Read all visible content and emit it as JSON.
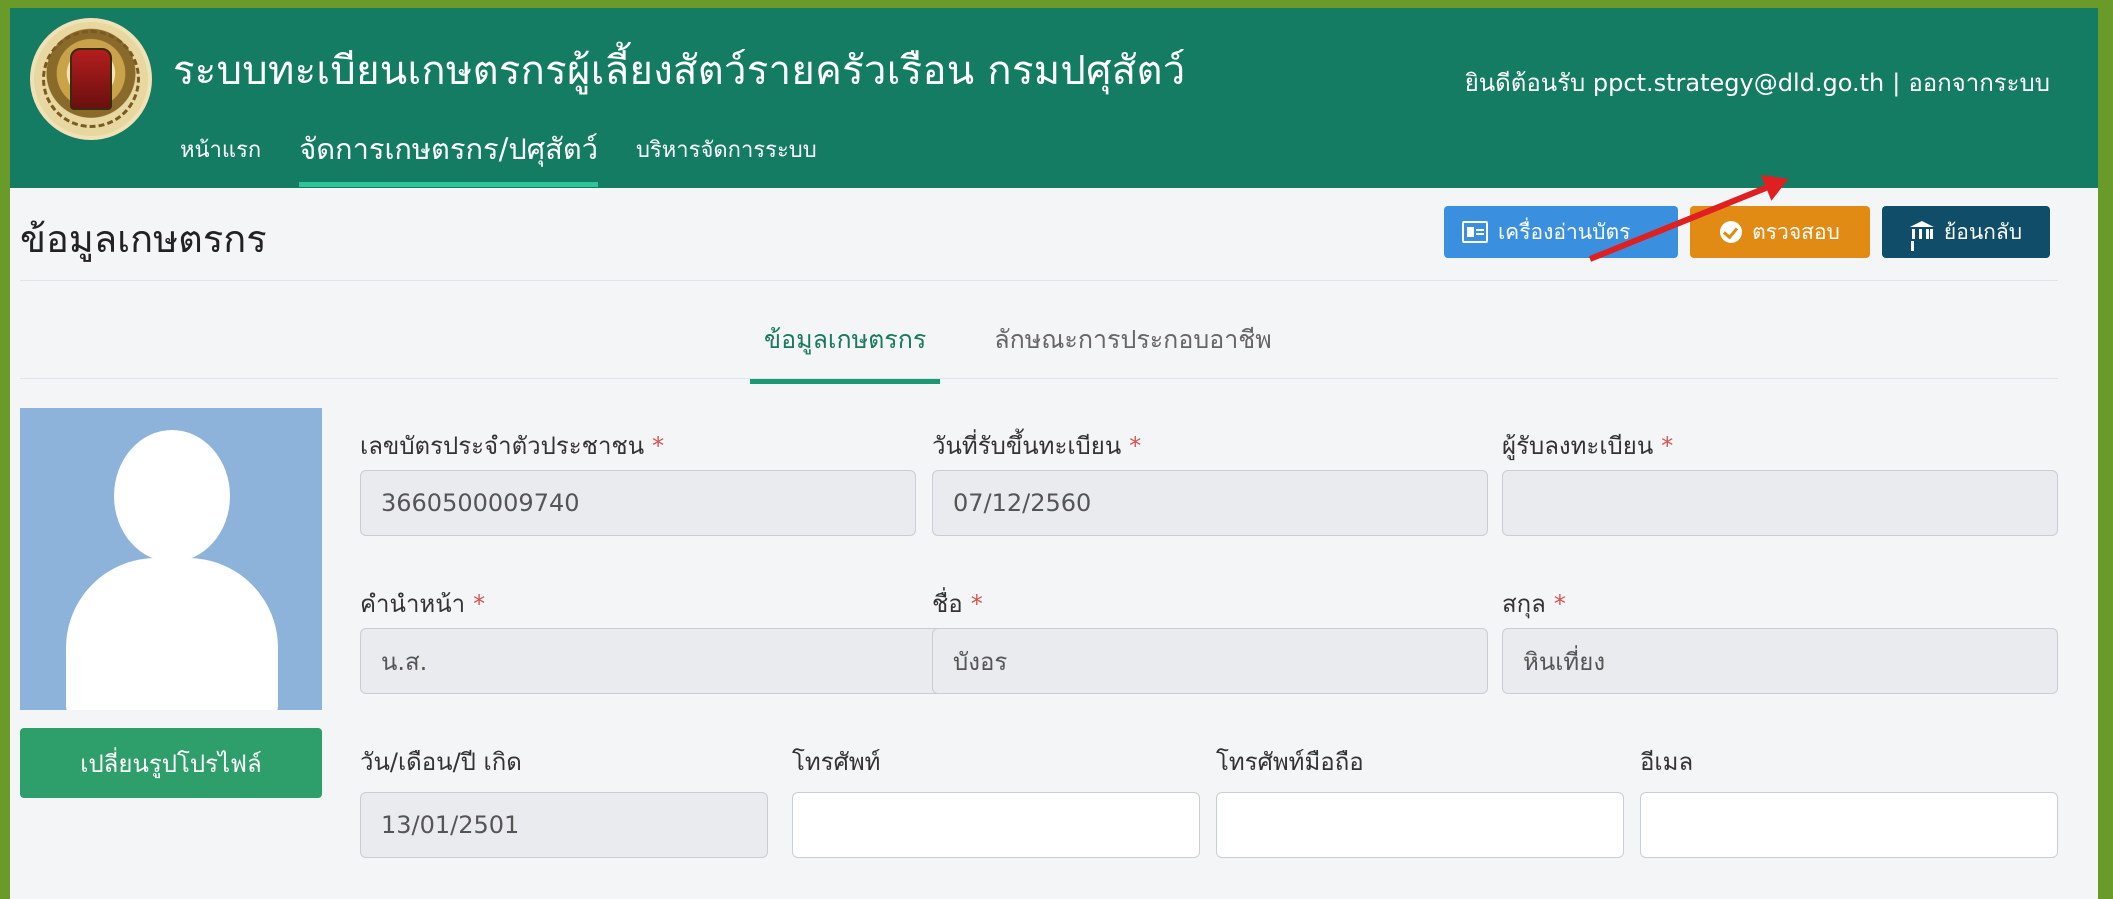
{
  "header": {
    "app_title": "ระบบทะเบียนเกษตรกรผู้เลี้ยงสัตว์รายครัวเรือน กรมปศุสัตว์",
    "nav": [
      "หน้าแรก",
      "จัดการเกษตรกร/ปศุสัตว์",
      "บริหารจัดการระบบ"
    ],
    "welcome": "ยินดีต้อนรับ ppct.strategy@dld.go.th",
    "separator": "|",
    "logout": "ออกจากระบบ"
  },
  "page": {
    "title": "ข้อมูลเกษตรกร",
    "actions": {
      "card_reader": "เครื่องอ่านบัตร",
      "verify": "ตรวจสอบ",
      "back": "ย้อนกลับ"
    },
    "tabs": [
      "ข้อมูลเกษตรกร",
      "ลักษณะการประกอบอาชีพ"
    ]
  },
  "profile": {
    "change_photo": "เปลี่ยนรูปโปรไฟล์"
  },
  "form": {
    "required_mark": "*",
    "id_card": {
      "label": "เลขบัตรประจำตัวประชาชน",
      "value": "3660500009740"
    },
    "register_date": {
      "label": "วันที่รับขึ้นทะเบียน",
      "value": "07/12/2560"
    },
    "registrar": {
      "label": "ผู้รับลงทะเบียน",
      "value": ""
    },
    "prefix": {
      "label": "คำนำหน้า",
      "value": "น.ส."
    },
    "first_name": {
      "label": "ชื่อ",
      "value": "บังอร"
    },
    "last_name": {
      "label": "สกุล",
      "value": "หินเที่ยง"
    },
    "birth_date": {
      "label": "วัน/เดือน/ปี เกิด",
      "value": "13/01/2501"
    },
    "phone": {
      "label": "โทรศัพท์",
      "value": ""
    },
    "mobile": {
      "label": "โทรศัพท์มือถือ",
      "value": ""
    },
    "email": {
      "label": "อีเมล",
      "value": ""
    }
  },
  "colors": {
    "header_bg": "#137c62",
    "verify_btn": "#e18a14",
    "card_btn": "#3a8fdf",
    "back_btn": "#0f4d68",
    "profile_btn": "#2e9e6a",
    "annotation_arrow": "#e02020"
  }
}
